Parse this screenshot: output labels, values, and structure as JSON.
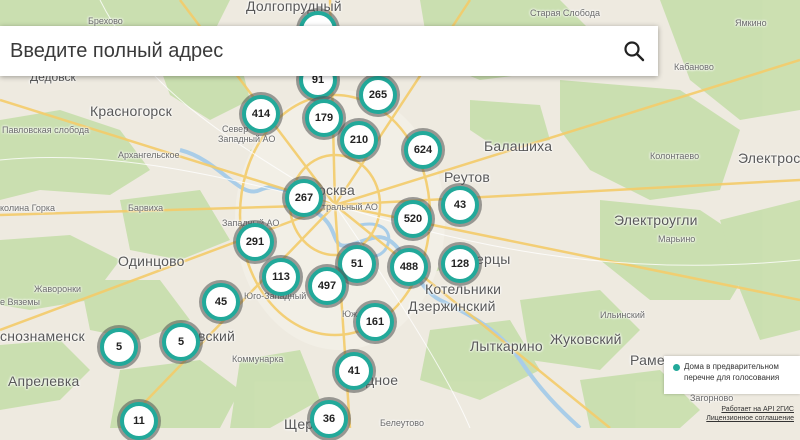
{
  "search": {
    "placeholder": "Введите полный адрес",
    "icon": "search-icon"
  },
  "map_labels": {
    "dolgoprudny": "Долгопрудный",
    "brehovo": "Брехово",
    "staraya_sloboda": "Старая Слобода",
    "yamkino": "Ямкино",
    "dedovsk": "Дедовск",
    "kabanovo": "Кабаново",
    "krasnogorsk": "Красногорск",
    "pavlovskaya_sloboda": "Павловская слобода",
    "arkhangelskoe": "Архангельское",
    "severny": "Север",
    "kolontaevo": "Колонтаево",
    "severo_zapadny_ao": "Западный АО",
    "balashikha": "Балашиха",
    "elektrostal": "Электрост",
    "moskva": "осква",
    "reutov": "Реутов",
    "kolonia_gorka": "колина Горка",
    "barvikha": "Барвиха",
    "tsentralny_ao": "тральный АО",
    "zapadny_ao": "Западный АО",
    "elektrougli": "Электроугли",
    "marino": "Марьино",
    "odintsovo": "Одинцово",
    "lyubertsy": "ерцы",
    "kotelniki": "Котельники",
    "zhavoronki": "Жаворонки",
    "yugo_zapadny": "Юго-Западный",
    "vyazemy": "е Вяземы",
    "dzerzhinsky": "Дзержинский",
    "krasnoznamensk": "снознаменск",
    "moskovsky": "вский",
    "yuzh": "Юж",
    "ilinsky": "Ильинский",
    "lytkarino": "Лыткарино",
    "zhukovsky": "Жуковский",
    "ramenskoe": "Рамен",
    "kommunarka": "Коммунарка",
    "aprelevka": "Апрелевка",
    "vidnoe": "дное",
    "zagornovo": "Загорново",
    "belyoutovo": "Белеутово",
    "shcher": "Щерб"
  },
  "clusters": [
    {
      "id": "c-top",
      "count": ""
    },
    {
      "id": "c-91",
      "count": "91"
    },
    {
      "id": "c-265",
      "count": "265"
    },
    {
      "id": "c-414",
      "count": "414"
    },
    {
      "id": "c-179",
      "count": "179"
    },
    {
      "id": "c-210",
      "count": "210"
    },
    {
      "id": "c-624",
      "count": "624"
    },
    {
      "id": "c-267",
      "count": "267"
    },
    {
      "id": "c-43",
      "count": "43"
    },
    {
      "id": "c-520",
      "count": "520"
    },
    {
      "id": "c-291",
      "count": "291"
    },
    {
      "id": "c-51",
      "count": "51"
    },
    {
      "id": "c-488",
      "count": "488"
    },
    {
      "id": "c-128",
      "count": "128"
    },
    {
      "id": "c-113",
      "count": "113"
    },
    {
      "id": "c-497",
      "count": "497"
    },
    {
      "id": "c-45",
      "count": "45"
    },
    {
      "id": "c-161",
      "count": "161"
    },
    {
      "id": "c-5a",
      "count": "5"
    },
    {
      "id": "c-5b",
      "count": "5"
    },
    {
      "id": "c-41",
      "count": "41"
    },
    {
      "id": "c-11",
      "count": "11"
    },
    {
      "id": "c-36",
      "count": "36"
    }
  ],
  "legend": {
    "text": "Дома в предварительном перечне для голосования",
    "color": "#22a99a"
  },
  "credits": {
    "line1": "Работает на API 2ГИС",
    "line2": "Лицензионное соглашение"
  },
  "colors": {
    "cluster_ring": "#22a99a",
    "land": "#eeeae0",
    "forest": "#c9dfae",
    "water": "#a9cde8",
    "roads": "#f4cc6a"
  }
}
